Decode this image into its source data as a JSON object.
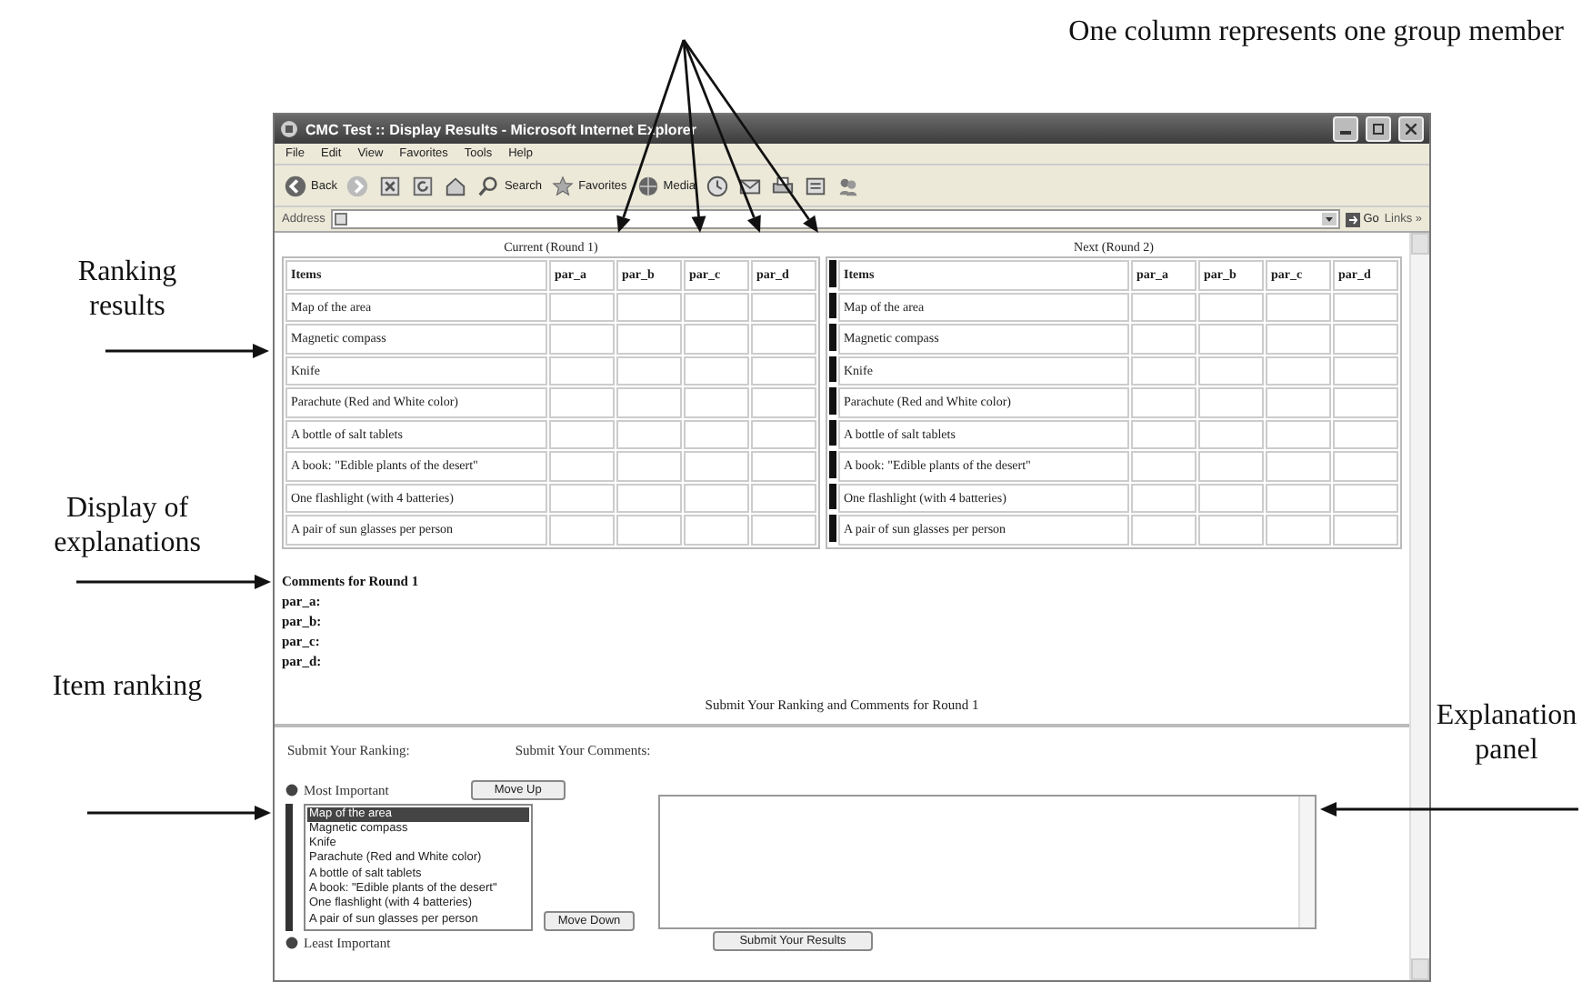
{
  "annotations": {
    "top": "One column represents one group member",
    "left": [
      {
        "text": "Ranking results"
      },
      {
        "text": "Display of explanations"
      },
      {
        "text": "Item ranking"
      }
    ],
    "right": [
      {
        "text": "Explanation panel"
      }
    ]
  },
  "window": {
    "title": "CMC Test :: Display Results - Microsoft Internet Explorer"
  },
  "menu": [
    "File",
    "Edit",
    "View",
    "Favorites",
    "Tools",
    "Help"
  ],
  "toolbar": [
    {
      "kind": "back",
      "label": "Back"
    },
    {
      "kind": "forward"
    },
    {
      "kind": "stop"
    },
    {
      "kind": "refresh"
    },
    {
      "kind": "home"
    },
    {
      "kind": "search",
      "label": "Search"
    },
    {
      "kind": "favorites",
      "label": "Favorites"
    },
    {
      "kind": "media",
      "label": "Media"
    },
    {
      "kind": "history"
    },
    {
      "kind": "mail"
    },
    {
      "kind": "print"
    },
    {
      "kind": "edit"
    },
    {
      "kind": "messenger"
    }
  ],
  "address": {
    "label": "Address",
    "go": "Go",
    "links": "Links »"
  },
  "tables": [
    {
      "caption": "Current (Round 1)",
      "row_markers": false,
      "columns": [
        "Items",
        "par_a",
        "par_b",
        "par_c",
        "par_d"
      ],
      "rows": [
        "Map of the area",
        "Magnetic compass",
        "Knife",
        "Parachute (Red and White color)",
        "A bottle of salt tablets",
        "A book: \"Edible plants of the desert\"",
        "One flashlight (with 4 batteries)",
        "A pair of sun glasses per person"
      ]
    },
    {
      "caption": "Next (Round 2)",
      "row_markers": true,
      "columns": [
        "Items",
        "par_a",
        "par_b",
        "par_c",
        "par_d"
      ],
      "rows": [
        "Map of the area",
        "Magnetic compass",
        "Knife",
        "Parachute (Red and White color)",
        "A bottle of salt tablets",
        "A book: \"Edible plants of the desert\"",
        "One flashlight (with 4 batteries)",
        "A pair of sun glasses per person"
      ]
    }
  ],
  "comments": {
    "heading": "Comments for Round 1",
    "participants": [
      "par_a:",
      "par_b:",
      "par_c:",
      "par_d:"
    ]
  },
  "submit_heading": "Submit Your Ranking and Comments for Round 1",
  "ranking": {
    "label": "Submit Your Ranking:",
    "most": "Most Important",
    "least": "Least Important",
    "move_up": "Move Up",
    "move_down": "Move Down",
    "items": [
      {
        "text": "Map of the area",
        "selected": true
      },
      {
        "text": "Magnetic compass",
        "selected": false
      },
      {
        "text": "Knife",
        "selected": false
      },
      {
        "text": "Parachute (Red and White color)",
        "selected": false
      },
      {
        "text": "A bottle of salt tablets",
        "selected": false
      },
      {
        "text": "A book: \"Edible plants of the desert\"",
        "selected": false
      },
      {
        "text": "One flashlight (with 4 batteries)",
        "selected": false
      },
      {
        "text": "A pair of sun glasses per person",
        "selected": false
      }
    ]
  },
  "comments_form": {
    "label": "Submit Your Comments:",
    "submit": "Submit Your Results"
  }
}
